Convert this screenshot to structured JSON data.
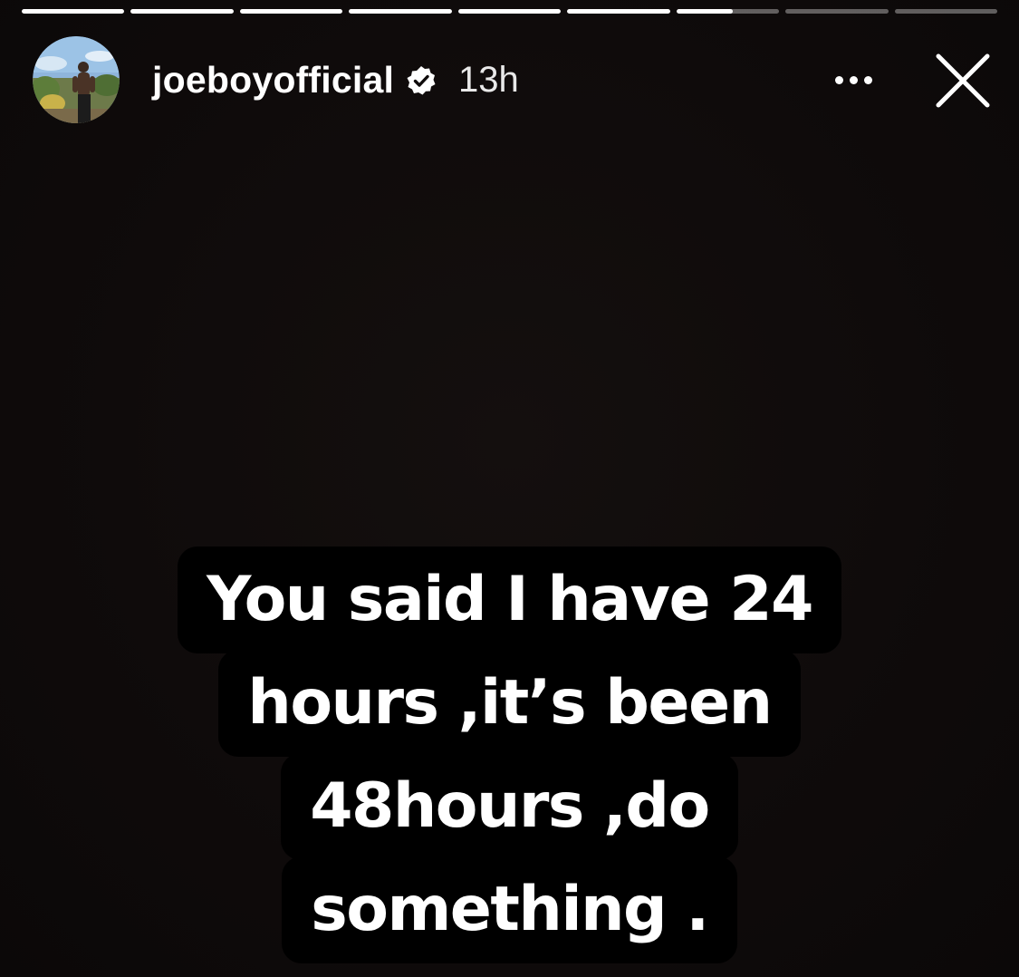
{
  "story": {
    "progress_segments": [
      1,
      1,
      1,
      1,
      1,
      1,
      0.55,
      0,
      0
    ],
    "colors": {
      "background": "#0f0b0b",
      "text": "#ffffff",
      "caption_bg": "#000000",
      "progress_track": "rgba(255,255,255,0.35)",
      "progress_fill": "#ffffff"
    }
  },
  "header": {
    "avatar_icon": "profile-avatar",
    "username": "joeboyofficial",
    "verified_icon": "verified-badge-icon",
    "time": "13h",
    "more_icon": "more-dots-icon",
    "close_icon": "close-icon"
  },
  "caption": {
    "lines": [
      "You said I have 24",
      "hours ,it’s been",
      "48hours ,do",
      "something ."
    ]
  }
}
